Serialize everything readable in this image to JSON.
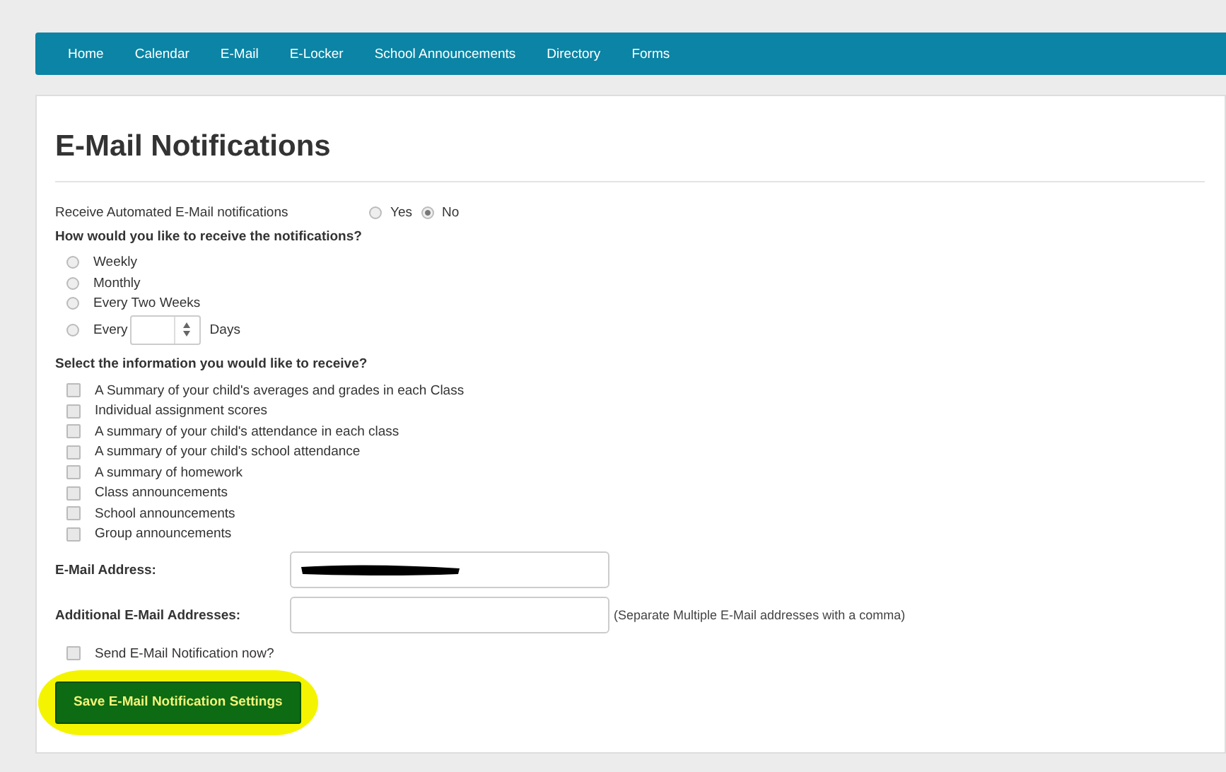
{
  "nav": [
    "Home",
    "Calendar",
    "E-Mail",
    "E-Locker",
    "School Announcements",
    "Directory",
    "Forms"
  ],
  "title": "E-Mail Notifications",
  "receive": {
    "label": "Receive Automated E-Mail notifications",
    "options": [
      {
        "label": "Yes",
        "selected": false
      },
      {
        "label": "No",
        "selected": true
      }
    ]
  },
  "frequency": {
    "heading": "How would you like to receive the notifications?",
    "options": [
      {
        "kind": "plain",
        "label": "Weekly",
        "selected": false
      },
      {
        "kind": "plain",
        "label": "Monthly",
        "selected": false
      },
      {
        "kind": "plain",
        "label": "Every Two Weeks",
        "selected": false
      },
      {
        "kind": "spinner",
        "label": "Every",
        "suffix": "Days",
        "selected": false
      }
    ]
  },
  "information": {
    "heading": "Select the information you would like to receive?",
    "items": [
      {
        "label": "A Summary of your child's averages and grades in each Class",
        "checked": false
      },
      {
        "label": "Individual assignment scores",
        "checked": false
      },
      {
        "label": "A summary of your child's attendance in each class",
        "checked": false
      },
      {
        "label": "A summary of your child's school attendance",
        "checked": false
      },
      {
        "label": "A summary of homework",
        "checked": false
      },
      {
        "label": "Class announcements",
        "checked": false
      },
      {
        "label": "School announcements",
        "checked": false
      },
      {
        "label": "Group announcements",
        "checked": false
      }
    ]
  },
  "email": {
    "label": "E-Mail Address:",
    "redacted": true
  },
  "additional": {
    "label": "Additional E-Mail Addresses:",
    "hint": "(Separate Multiple E-Mail addresses with a comma)"
  },
  "send_now": {
    "label": "Send E-Mail Notification now?",
    "checked": false
  },
  "save_button": {
    "label": "Save E-Mail Notification Settings",
    "highlighted": true
  }
}
